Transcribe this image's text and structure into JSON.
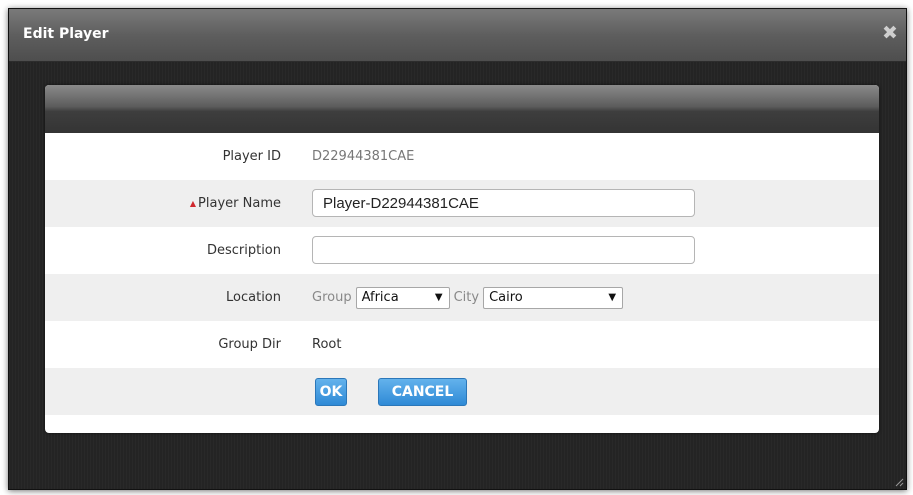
{
  "dialog": {
    "title": "Edit Player",
    "close_glyph": "✖"
  },
  "form": {
    "player_id": {
      "label": "Player ID",
      "value": "D22944381CAE"
    },
    "player_name": {
      "required_marker": "▲",
      "label": "Player Name",
      "value": "Player-D22944381CAE",
      "placeholder": ""
    },
    "description": {
      "label": "Description",
      "value": "",
      "placeholder": ""
    },
    "location": {
      "label": "Location",
      "group_label": "Group",
      "group_value": "Africa",
      "city_label": "City",
      "city_value": "Cairo",
      "arrow_glyph": "▼"
    },
    "group_dir": {
      "label": "Group Dir",
      "value": "Root"
    }
  },
  "buttons": {
    "ok": "OK",
    "cancel": "CANCEL"
  },
  "icons": {
    "close": "close-icon",
    "dropdown": "chevron-down-icon",
    "resize": "resize-grip-icon"
  }
}
